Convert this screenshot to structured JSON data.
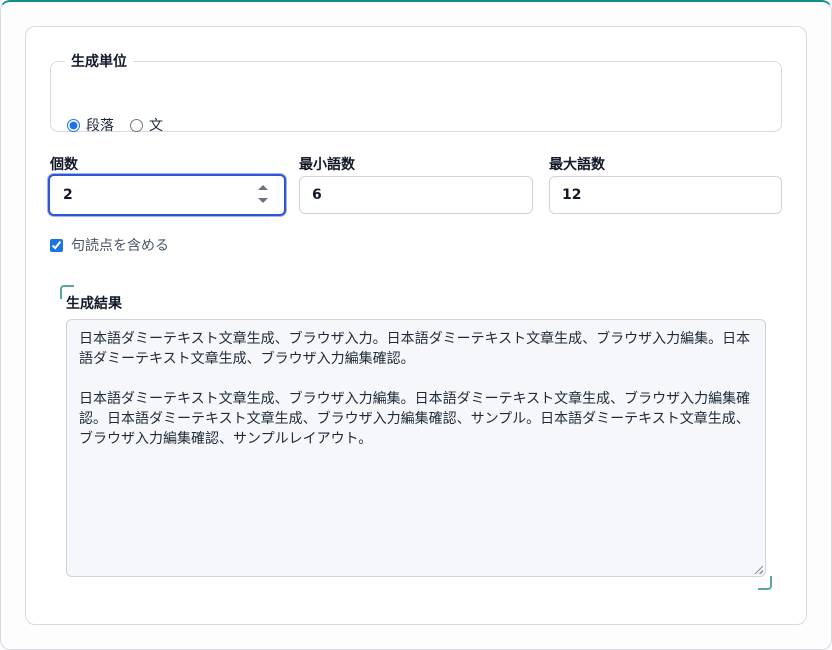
{
  "unit": {
    "legend": "生成単位",
    "options": [
      {
        "label": "段落",
        "checked": true
      },
      {
        "label": "文",
        "checked": false
      }
    ]
  },
  "fields": {
    "count": {
      "label": "個数",
      "value": "2"
    },
    "min_words": {
      "label": "最小語数",
      "value": "6"
    },
    "max_words": {
      "label": "最大語数",
      "value": "12"
    }
  },
  "punctuation": {
    "label": "句読点を含める",
    "checked": true
  },
  "result": {
    "label": "生成結果",
    "paragraphs": [
      "日本語ダミーテキスト文章生成、ブラウザ入力。日本語ダミーテキスト文章生成、ブラウザ入力編集。日本語ダミーテキスト文章生成、ブラウザ入力編集確認。",
      "日本語ダミーテキスト文章生成、ブラウザ入力編集。日本語ダミーテキスト文章生成、ブラウザ入力編集確認。日本語ダミーテキスト文章生成、ブラウザ入力編集確認、サンプル。日本語ダミーテキスト文章生成、ブラウザ入力編集確認、サンプルレイアウト。"
    ]
  },
  "colors": {
    "accent": "#0f8f86",
    "focus": "#2f55d4",
    "textarea_bg": "#f5f7fa"
  }
}
